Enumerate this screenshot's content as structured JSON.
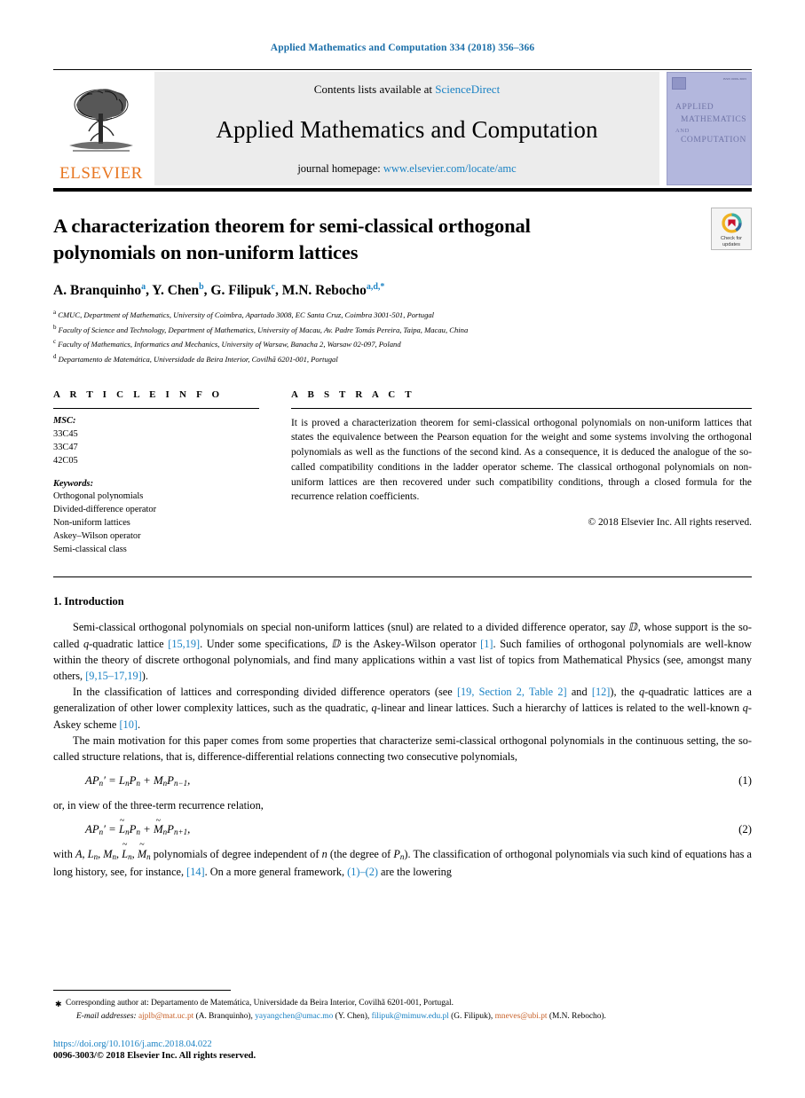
{
  "running_head": "Applied Mathematics and Computation 334 (2018) 356–366",
  "masthead": {
    "contents_prefix": "Contents lists available at ",
    "sciencedirect": "ScienceDirect",
    "journal_title": "Applied Mathematics and Computation",
    "homepage_prefix": "journal homepage: ",
    "homepage_url": "www.elsevier.com/locate/amc",
    "publisher": "ELSEVIER",
    "cover": {
      "line1": "APPLIED",
      "line2": "MATHEMATICS",
      "line3": "AND",
      "line4": "COMPUTATION",
      "issn": "ISSN 0096-3003"
    },
    "accent_link_color": "#1a82c4",
    "publisher_color": "#e87722"
  },
  "article": {
    "title": "A characterization theorem for semi-classical orthogonal polynomials on non-uniform lattices",
    "crossmark_label": "Check for\nupdates",
    "authors": [
      {
        "name": "A. Branquinho",
        "marks": "a"
      },
      {
        "name": "Y. Chen",
        "marks": "b"
      },
      {
        "name": "G. Filipuk",
        "marks": "c"
      },
      {
        "name": "M.N. Rebocho",
        "marks": "a,d,*"
      }
    ],
    "affiliations": [
      {
        "mark": "a",
        "text": "CMUC, Department of Mathematics, University of Coimbra, Apartado 3008, EC Santa Cruz, Coimbra 3001-501, Portugal"
      },
      {
        "mark": "b",
        "text": "Faculty of Science and Technology, Department of Mathematics, University of Macau, Av. Padre Tomás Pereira, Taipa, Macau, China"
      },
      {
        "mark": "c",
        "text": "Faculty of Mathematics, Informatics and Mechanics, University of Warsaw, Banacha 2, Warsaw 02-097, Poland"
      },
      {
        "mark": "d",
        "text": "Departamento de Matemática, Universidade da Beira Interior, Covilhã 6201-001, Portugal"
      }
    ]
  },
  "article_info": {
    "heading": "A R T I C L E   I N F O",
    "msc_label": "MSC:",
    "msc_codes": [
      "33C45",
      "33C47",
      "42C05"
    ],
    "keywords_label": "Keywords:",
    "keywords": [
      "Orthogonal polynomials",
      "Divided-difference operator",
      "Non-uniform lattices",
      "Askey–Wilson operator",
      "Semi-classical class"
    ]
  },
  "abstract": {
    "heading": "A B S T R A C T",
    "text": "It is proved a characterization theorem for semi-classical orthogonal polynomials on non-uniform lattices that states the equivalence between the Pearson equation for the weight and some systems involving the orthogonal polynomials as well as the functions of the second kind. As a consequence, it is deduced the analogue of the so-called compatibility conditions in the ladder operator scheme. The classical orthogonal polynomials on non-uniform lattices are then recovered under such compatibility conditions, through a closed formula for the recurrence relation coefficients.",
    "copyright": "© 2018 Elsevier Inc. All rights reserved."
  },
  "introduction": {
    "heading": "1. Introduction",
    "p1_a": "Semi-classical orthogonal polynomials on special non-uniform lattices (snul) are related to a divided difference operator, say ⅅ, whose support is the so-called ",
    "p1_q": "q",
    "p1_b": "-quadratic lattice ",
    "p1_cit1": "[15,19]",
    "p1_c": ". Under some specifications, ⅅ is the Askey-Wilson operator ",
    "p1_cit2": "[1]",
    "p1_d": ". Such families of orthogonal polynomials are well-know within the theory of discrete orthogonal polynomials, and find many applications within a vast list of topics from Mathematical Physics (see, amongst many others, ",
    "p1_cit3": "[9,15–17,19]",
    "p1_e": ").",
    "p2_a": "In the classification of lattices and corresponding divided difference operators (see ",
    "p2_cit1": "[19, Section 2, Table 2]",
    "p2_b": " and ",
    "p2_cit2": "[12]",
    "p2_c": "), the ",
    "p2_q": "q",
    "p2_d": "-quadratic lattices are a generalization of other lower complexity lattices, such as the quadratic, ",
    "p2_q2": "q",
    "p2_e": "-linear and linear lattices. Such a hierarchy of lattices is related to the well-known ",
    "p2_q3": "q",
    "p2_f": "-Askey scheme ",
    "p2_cit3": "[10]",
    "p2_g": ".",
    "p3_a": "The main motivation for this paper comes from some properties that characterize semi-classical orthogonal polynomials in the continuous setting, the so-called structure relations, that is, difference-differential relations connecting two consecutive polynomials,",
    "eq1_num": "(1)",
    "eq2_num": "(2)",
    "between_eq": "or, in view of the three-term recurrence relation,",
    "p4_a": "with ",
    "p4_b": " polynomials of degree independent of ",
    "p4_n": "n",
    "p4_c": " (the degree of ",
    "p4_d": "). The classification of orthogonal polynomials via such kind of equations has a long history, see, for instance, ",
    "p4_cit1": "[14]",
    "p4_e": ". On a more general framework, ",
    "p4_cit2": "(1)–(2)",
    "p4_f": " are the lowering"
  },
  "footnotes": {
    "corresponding": "Corresponding author at: Departamento de Matemática, Universidade da Beira Interior, Covilhã 6201-001, Portugal.",
    "emails_label": "E-mail addresses:",
    "emails": [
      {
        "address": "ajplb@mat.uc.pt",
        "person": "(A. Branquinho)",
        "color": "#c8622a"
      },
      {
        "address": "yayangchen@umac.mo",
        "person": "(Y. Chen)",
        "color": "#1a82c4"
      },
      {
        "address": "filipuk@mimuw.edu.pl",
        "person": "(G. Filipuk)",
        "color": "#1a82c4"
      },
      {
        "address": "mneves@ubi.pt",
        "person": "(M.N. Rebocho)",
        "color": "#c8622a"
      }
    ],
    "doi": "https://doi.org/10.1016/j.amc.2018.04.022",
    "issn_line": "0096-3003/© 2018 Elsevier Inc. All rights reserved."
  }
}
